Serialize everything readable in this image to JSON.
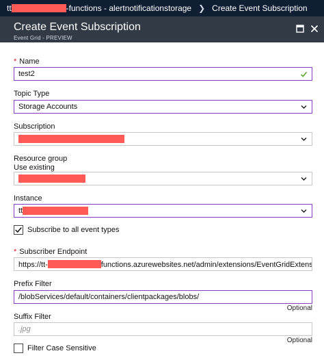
{
  "breadcrumb": {
    "prefix": "tt",
    "suffix": "-functions - alertnotificationstorage",
    "current": "Create Event Subscription"
  },
  "blade": {
    "title": "Create Event Subscription",
    "subtitle": "Event Grid - PREVIEW"
  },
  "form": {
    "name": {
      "label": "Name",
      "value": "test2"
    },
    "topic_type": {
      "label": "Topic Type",
      "value": "Storage Accounts"
    },
    "subscription": {
      "label": "Subscription"
    },
    "resource_group": {
      "label": "Resource group",
      "mode": "Use existing"
    },
    "instance": {
      "label": "Instance",
      "prefix": "tt"
    },
    "subscribe_all": {
      "label": "Subscribe to all event types",
      "checked": true
    },
    "subscriber_endpoint": {
      "label": "Subscriber Endpoint",
      "prefix": "https://tt-",
      "suffix": "functions.azurewebsites.net/admin/extensions/EventGridExtensionC..."
    },
    "prefix_filter": {
      "label": "Prefix Filter",
      "value": "/blobServices/default/containers/clientpackages/blobs/",
      "optional": "Optional"
    },
    "suffix_filter": {
      "label": "Suffix Filter",
      "placeholder": ".jpg",
      "optional": "Optional"
    },
    "case_sensitive": {
      "label": "Filter Case Sensitive",
      "checked": false
    }
  },
  "colors": {
    "breadcrumb_bg": "#0f1e33",
    "header_bg": "#323a46",
    "focus_border": "#8a3cc3",
    "redaction": "#ff5a55",
    "valid_check": "#5ba82c",
    "required": "#e0142a"
  }
}
